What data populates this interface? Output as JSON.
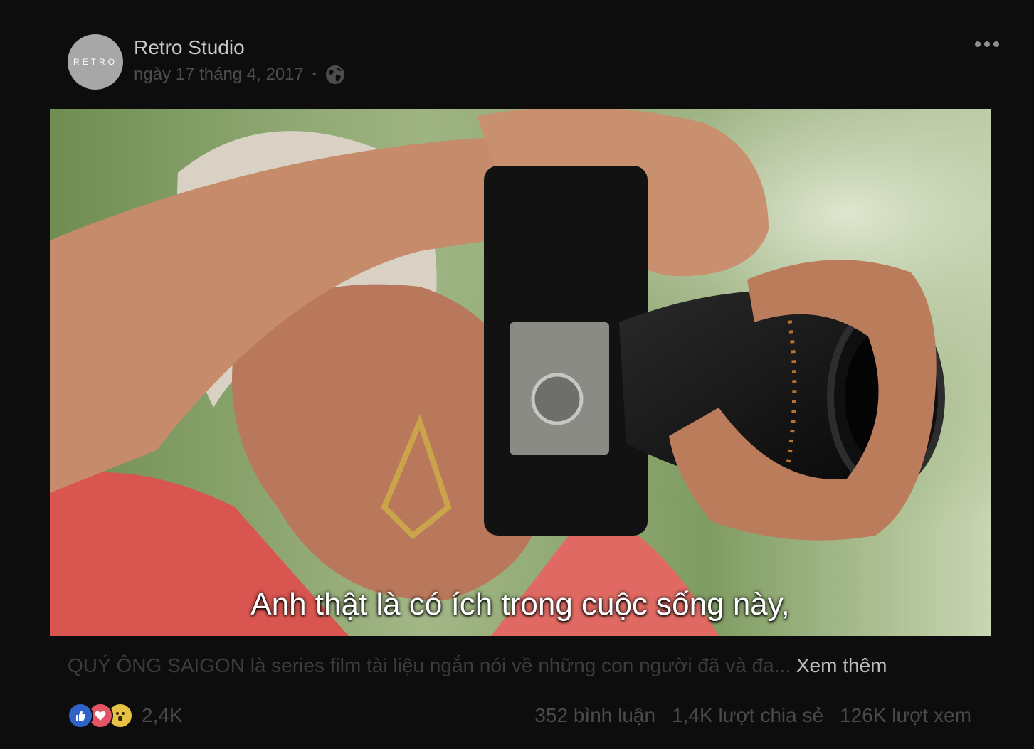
{
  "post": {
    "page_name": "Retro Studio",
    "avatar_text": "RETRO",
    "date": "ngày 17 tháng 4, 2017",
    "privacy_icon": "globe-icon",
    "more_icon": "more-options-icon",
    "video": {
      "subtitle": "Anh thật là có ích trong cuộc sống này,"
    },
    "caption": {
      "text": "QUÝ ÔNG SAIGON là series film tài liệu ngắn nói về những con người đã và đa...",
      "see_more": "Xem thêm"
    },
    "reactions": {
      "icons": [
        "like-reaction-icon",
        "love-reaction-icon",
        "wow-reaction-icon"
      ],
      "count": "2,4K"
    },
    "stats": {
      "comments": "352 bình luận",
      "shares": "1,4K lượt chia sẻ",
      "views": "126K lượt xem"
    }
  },
  "colors": {
    "background": "#0d0d0e",
    "name_text": "#c9c9cb",
    "muted_text": "#4d4d50",
    "like": "#2f63c9",
    "love": "#e35465",
    "wow": "#e7c245"
  }
}
